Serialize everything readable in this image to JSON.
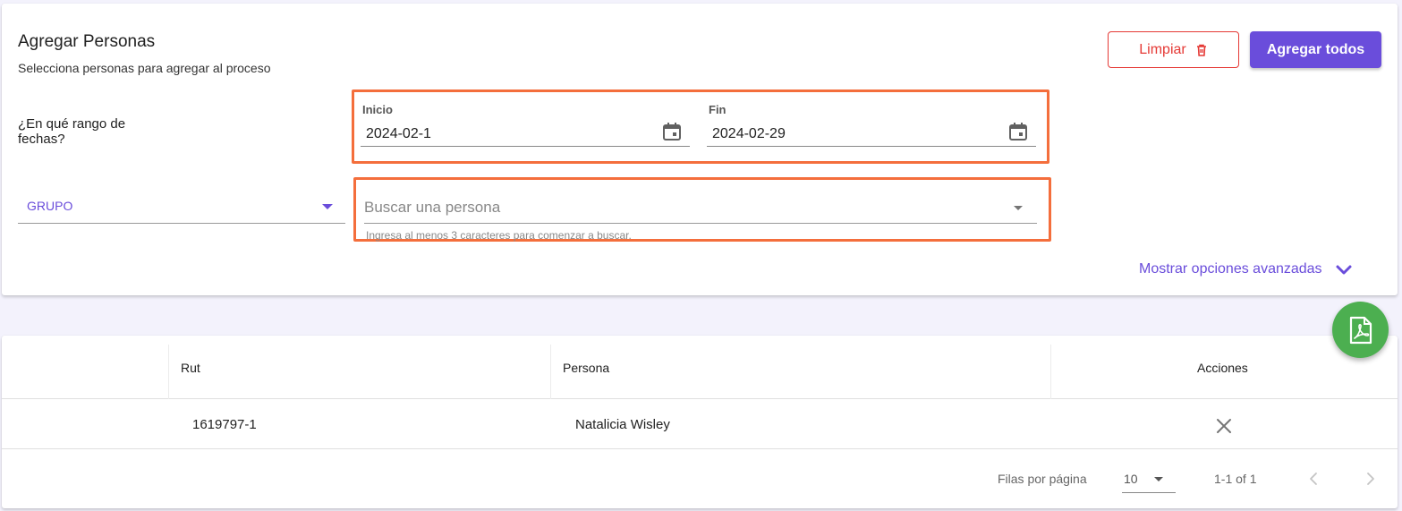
{
  "header": {
    "title": "Agregar Personas",
    "subtitle": "Selecciona personas para agregar al proceso",
    "clear_label": "Limpiar",
    "add_all_label": "Agregar todos"
  },
  "date_range": {
    "question": "¿En qué rango de fechas?",
    "start_label": "Inicio",
    "start_value": "2024-02-1",
    "end_label": "Fin",
    "end_value": "2024-02-29"
  },
  "filters": {
    "group_label": "GRUPO",
    "search_placeholder": "Buscar una persona",
    "search_hint": "Ingresa al menos 3 caracteres para comenzar a buscar.",
    "advanced_label": "Mostrar opciones avanzadas"
  },
  "table": {
    "headers": {
      "rut": "Rut",
      "persona": "Persona",
      "acciones": "Acciones"
    },
    "rows": [
      {
        "rut": "1619797-1",
        "persona": "Natalicia Wisley"
      }
    ]
  },
  "pagination": {
    "rows_per_page_label": "Filas por página",
    "rows_per_page_value": "10",
    "range_text": "1-1 of 1"
  },
  "colors": {
    "primary": "#6a4ddb",
    "danger": "#e53935",
    "highlight": "#f46e3c",
    "fab": "#4caf50"
  },
  "icons": {
    "clear": "trash-icon",
    "date": "calendar-icon",
    "dropdown": "caret-down-icon",
    "advanced": "chevron-down-icon",
    "fab": "pdf-icon",
    "remove": "close-icon",
    "prev": "chevron-left-icon",
    "next": "chevron-right-icon"
  }
}
